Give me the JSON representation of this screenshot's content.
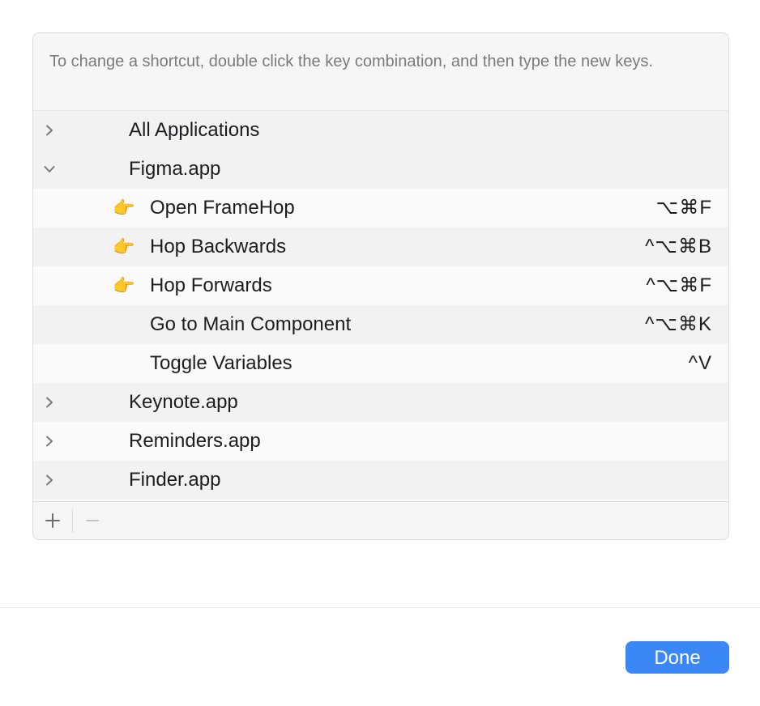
{
  "instructions": "To change a shortcut, double click the key combination, and then type the new keys.",
  "rows": [
    {
      "kind": "app",
      "label": "All Applications",
      "expanded": false
    },
    {
      "kind": "app",
      "label": "Figma.app",
      "expanded": true
    },
    {
      "kind": "cmd",
      "emoji": "👉",
      "label": "Open FrameHop",
      "shortcut": "⌥⌘F"
    },
    {
      "kind": "cmd",
      "emoji": "👉",
      "label": "Hop Backwards",
      "shortcut": "^⌥⌘B"
    },
    {
      "kind": "cmd",
      "emoji": "👉",
      "label": "Hop Forwards",
      "shortcut": "^⌥⌘F"
    },
    {
      "kind": "cmd",
      "emoji": "",
      "label": "Go to Main Component",
      "shortcut": "^⌥⌘K"
    },
    {
      "kind": "cmd",
      "emoji": "",
      "label": "Toggle Variables",
      "shortcut": "^V"
    },
    {
      "kind": "app",
      "label": "Keynote.app",
      "expanded": false
    },
    {
      "kind": "app",
      "label": "Reminders.app",
      "expanded": false
    },
    {
      "kind": "app",
      "label": "Finder.app",
      "expanded": false
    }
  ],
  "footer": {
    "add_icon": "plus-icon",
    "remove_icon": "minus-icon"
  },
  "done_label": "Done",
  "colors": {
    "accent": "#3b87f5"
  }
}
